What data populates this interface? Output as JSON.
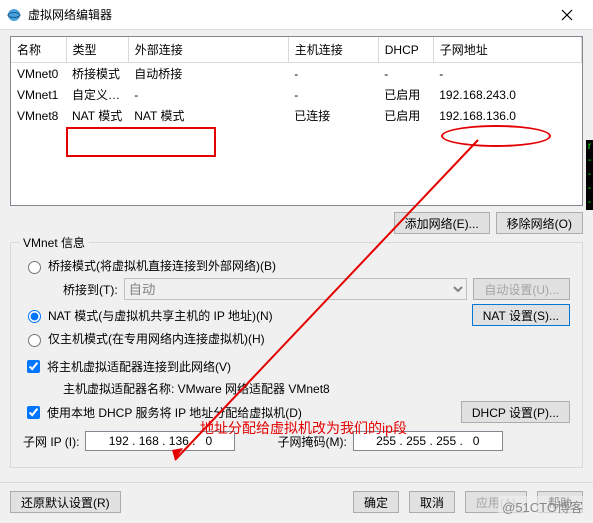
{
  "titlebar": {
    "title": "虚拟网络编辑器"
  },
  "columns": {
    "name": "名称",
    "type": "类型",
    "external": "外部连接",
    "host_conn": "主机连接",
    "dhcp": "DHCP",
    "subnet": "子网地址"
  },
  "rows": [
    {
      "name": "VMnet0",
      "type": "桥接模式",
      "external": "自动桥接",
      "host_conn": "-",
      "dhcp": "-",
      "subnet": "-"
    },
    {
      "name": "VMnet1",
      "type": "自定义…",
      "external": "-",
      "host_conn": "-",
      "dhcp": "已启用",
      "subnet": "192.168.243.0"
    },
    {
      "name": "VMnet8",
      "type": "NAT 模式",
      "external": "NAT 模式",
      "host_conn": "已连接",
      "dhcp": "已启用",
      "subnet": "192.168.136.0"
    }
  ],
  "buttons": {
    "add_network": "添加网络(E)...",
    "remove_network": "移除网络(O)",
    "auto_set": "自动设置(U)...",
    "nat_set": "NAT 设置(S)...",
    "dhcp_set": "DHCP 设置(P)...",
    "restore": "还原默认设置(R)",
    "ok": "确定",
    "cancel": "取消",
    "apply": "应用(A)",
    "help": "帮助"
  },
  "vmnet_info": {
    "title": "VMnet 信息",
    "bridge_label": "桥接模式(将虚拟机直接连接到外部网络)(B)",
    "bridge_to": "桥接到(T):",
    "bridge_sel": "自动",
    "nat_label": "NAT 模式(与虚拟机共享主机的 IP 地址)(N)",
    "hostonly_label": "仅主机模式(在专用网络内连接虚拟机)(H)",
    "connect_host": "将主机虚拟适配器连接到此网络(V)",
    "adapter_name_label": "主机虚拟适配器名称: VMware 网络适配器 VMnet8",
    "use_dhcp": "使用本地 DHCP 服务将 IP 地址分配给虚拟机(D)",
    "subnet_ip_label": "子网 IP (I):",
    "subnet_ip": "192 . 168 . 136 .   0",
    "subnet_mask_label": "子网掩码(M):",
    "subnet_mask": "255 . 255 . 255 .   0"
  },
  "annotation": "地址分配给虚拟机改为我们的ip段",
  "watermark": "@51CTO博客"
}
